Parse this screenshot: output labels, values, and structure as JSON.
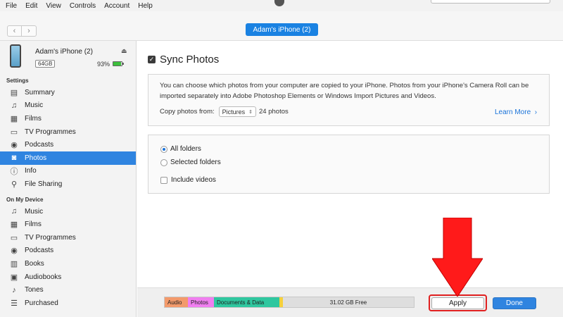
{
  "menu": [
    "File",
    "Edit",
    "View",
    "Controls",
    "Account",
    "Help"
  ],
  "nav": {
    "back": "‹",
    "forward": "›",
    "device_pill": "Adam's iPhone (2)"
  },
  "device": {
    "name": "Adam's iPhone (2)",
    "capacity": "64GB",
    "battery_pct": "93%",
    "battery_level": 0.93,
    "eject": "⏏"
  },
  "sidebar": {
    "settings_header": "Settings",
    "settings_items": [
      {
        "label": "Summary",
        "icon": "summary-icon",
        "glyph": "▤"
      },
      {
        "label": "Music",
        "icon": "music-icon",
        "glyph": "♫"
      },
      {
        "label": "Films",
        "icon": "film-icon",
        "glyph": "▦"
      },
      {
        "label": "TV Programmes",
        "icon": "tv-icon",
        "glyph": "▭"
      },
      {
        "label": "Podcasts",
        "icon": "podcast-icon",
        "glyph": "◉"
      },
      {
        "label": "Photos",
        "icon": "camera-icon",
        "glyph": "◙"
      },
      {
        "label": "Info",
        "icon": "info-icon",
        "glyph": "ⓘ"
      },
      {
        "label": "File Sharing",
        "icon": "file-sharing-icon",
        "glyph": "⚲"
      }
    ],
    "device_header": "On My Device",
    "device_items": [
      {
        "label": "Music",
        "icon": "music-icon",
        "glyph": "♫"
      },
      {
        "label": "Films",
        "icon": "film-icon",
        "glyph": "▦"
      },
      {
        "label": "TV Programmes",
        "icon": "tv-icon",
        "glyph": "▭"
      },
      {
        "label": "Podcasts",
        "icon": "podcast-icon",
        "glyph": "◉"
      },
      {
        "label": "Books",
        "icon": "books-icon",
        "glyph": "▥"
      },
      {
        "label": "Audiobooks",
        "icon": "audiobooks-icon",
        "glyph": "▣"
      },
      {
        "label": "Tones",
        "icon": "bell-icon",
        "glyph": "♪"
      },
      {
        "label": "Purchased",
        "icon": "purchased-icon",
        "glyph": "☰"
      }
    ]
  },
  "main": {
    "sync_title": "Sync Photos",
    "description": "You can choose which photos from your computer are copied to your iPhone. Photos from your iPhone's Camera Roll can be imported separately into Adobe Photoshop Elements or Windows Import Pictures and Videos.",
    "copy_label": "Copy photos from:",
    "copy_source": "Pictures",
    "photo_count": "24 photos",
    "learn_more": "Learn More",
    "options": {
      "all_folders": "All folders",
      "selected_folders": "Selected folders",
      "include_videos": "Include videos"
    }
  },
  "storage": {
    "audio": "Audio",
    "photos": "Photos",
    "docs": "Documents & Data",
    "free": "31.02 GB Free"
  },
  "buttons": {
    "apply": "Apply",
    "done": "Done"
  },
  "colors": {
    "accent": "#2f84e0",
    "audio": "#f39a6b",
    "photos": "#f07ef0",
    "docs": "#2fc79f",
    "other": "#f5d13c",
    "highlight": "#e02020"
  }
}
